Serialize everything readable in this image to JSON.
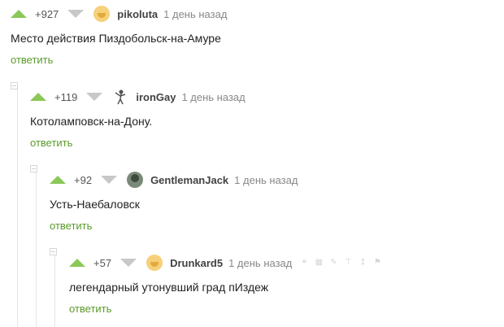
{
  "comments": [
    {
      "score": "+927",
      "username": "pikoluta",
      "time": "1 день назад",
      "text": "Место действия Пиздобольск-на-Амуре",
      "reply": "ответить",
      "avatar": "yellow-face-avatar"
    },
    {
      "score": "+119",
      "username": "ironGay",
      "time": "1 день назад",
      "text": "Котоламповск-на-Дону.",
      "reply": "ответить",
      "avatar": "stick-figure-avatar"
    },
    {
      "score": "+92",
      "username": "GentlemanJack",
      "time": "1 день назад",
      "text": "Усть-Наебаловск",
      "reply": "ответить",
      "avatar": "dark-photo-avatar"
    },
    {
      "score": "+57",
      "username": "Drunkard5",
      "time": "1 день назад",
      "text": "легендарный утонувший град пИздеж",
      "reply": "ответить",
      "avatar": "yellow-face-avatar"
    }
  ],
  "colors": {
    "upvote": "#8ac858",
    "downvote": "#c8c8c8",
    "reply": "#5a9a2a",
    "username": "#424242",
    "time": "#888888"
  },
  "icons": [
    "link-icon",
    "save-icon",
    "edit-icon",
    "pin-icon",
    "share-icon",
    "flag-icon"
  ]
}
